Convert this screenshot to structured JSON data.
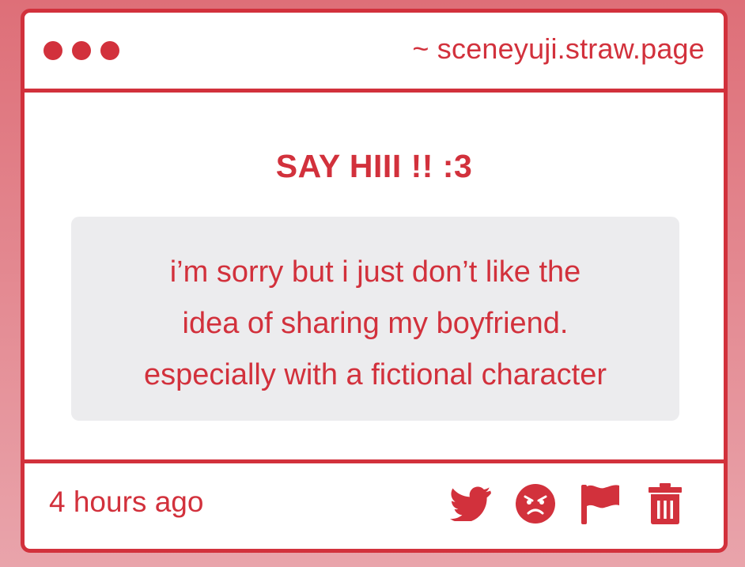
{
  "window": {
    "url": "~ sceneyuji.straw.page",
    "dots": [
      "dot",
      "dot",
      "dot"
    ]
  },
  "card": {
    "title": "SAY HIII !! :3",
    "message_lines": [
      "i’m sorry but i just don’t like the",
      "idea of sharing my boyfriend.",
      "especially with a fictional character"
    ]
  },
  "footer": {
    "timestamp": "4 hours ago",
    "actions": [
      "twitter-icon",
      "angry-face-icon",
      "flag-icon",
      "trash-icon"
    ]
  },
  "colors": {
    "accent": "#d2313c",
    "message_bg": "#ececee",
    "page_bg_top": "#de6f78",
    "page_bg_bottom": "#e9a4ab"
  }
}
